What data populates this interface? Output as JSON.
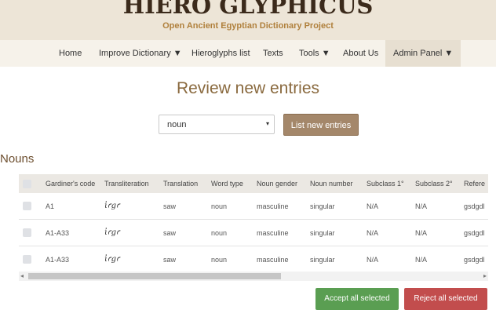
{
  "header": {
    "logo_text": "HIERO GLYPHICUS",
    "subtitle": "Open Ancient Egyptian Dictionary Project"
  },
  "nav": {
    "items": [
      {
        "label": "Home"
      },
      {
        "label": "Improve Dictionary ▼"
      },
      {
        "label": "Hieroglyphs list"
      },
      {
        "label": "Texts"
      },
      {
        "label": "Tools ▼"
      },
      {
        "label": "About Us"
      },
      {
        "label": "Admin Panel ▼"
      }
    ]
  },
  "main": {
    "title": "Review new entries",
    "filter": {
      "selected": "noun",
      "arrow": "▾"
    },
    "list_button": "List new entries",
    "section_title": "Nouns"
  },
  "table": {
    "headers": [
      "Gardiner's code",
      "Transliteration",
      "Translation",
      "Word type",
      "Noun gender",
      "Noun number",
      "Subclass 1°",
      "Subclass 2°",
      "Refere"
    ],
    "rows": [
      [
        "A1",
        "ἰꜥgꜥ",
        "saw",
        "noun",
        "masculine",
        "singular",
        "N/A",
        "N/A",
        "gsdgdl"
      ],
      [
        "A1-A33",
        "ἰꜥgꜥ",
        "saw",
        "noun",
        "masculine",
        "singular",
        "N/A",
        "N/A",
        "gsdgdl"
      ],
      [
        "A1-A33",
        "ἰꜥgꜥ",
        "saw",
        "noun",
        "masculine",
        "singular",
        "N/A",
        "N/A",
        "gsdgdl"
      ]
    ]
  },
  "scrollbar": {
    "left_arrow": "◂",
    "right_arrow": "▸"
  },
  "actions": {
    "accept": "Accept all selected",
    "reject": "Reject all selected"
  },
  "colors": {
    "header_bg": "#ede5d7",
    "brand_gold": "#b0803c",
    "list_button": "#a4876a",
    "accept": "#5a9e52",
    "reject": "#c24d4d"
  }
}
